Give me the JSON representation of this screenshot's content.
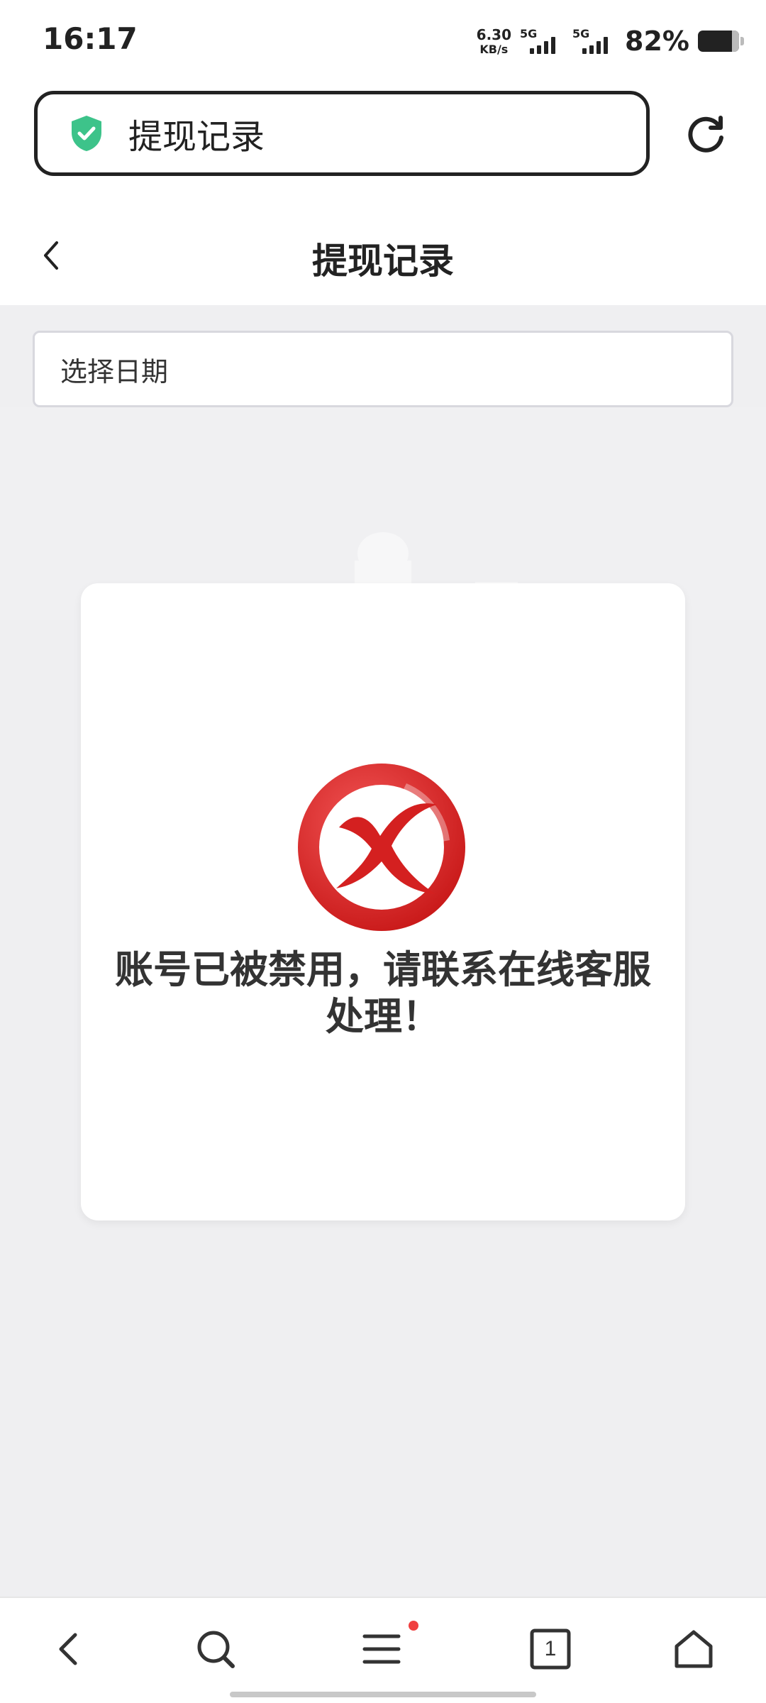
{
  "status_bar": {
    "time": "16:17",
    "net_speed_value": "6.30",
    "net_speed_unit": "KB/s",
    "sim1_label": "5G",
    "sim2_label": "5G",
    "battery_percent": "82%"
  },
  "browser": {
    "url_text": "提现记录",
    "secure_icon": "shield-check-icon",
    "refresh_icon": "refresh-icon"
  },
  "header": {
    "title": "提现记录",
    "back_icon": "chevron-left-icon"
  },
  "filter": {
    "date_placeholder": "选择日期"
  },
  "modal": {
    "icon": "error-x-icon",
    "message": "账号已被禁用，请联系在线客服处理！"
  },
  "bottom_nav": {
    "tab_count": "1",
    "items": [
      "back-icon",
      "search-icon",
      "menu-icon",
      "tabs-icon",
      "home-icon"
    ]
  },
  "colors": {
    "accent_green": "#3dc38a",
    "error_red": "#e02a2a",
    "notification_dot": "#f04040"
  }
}
